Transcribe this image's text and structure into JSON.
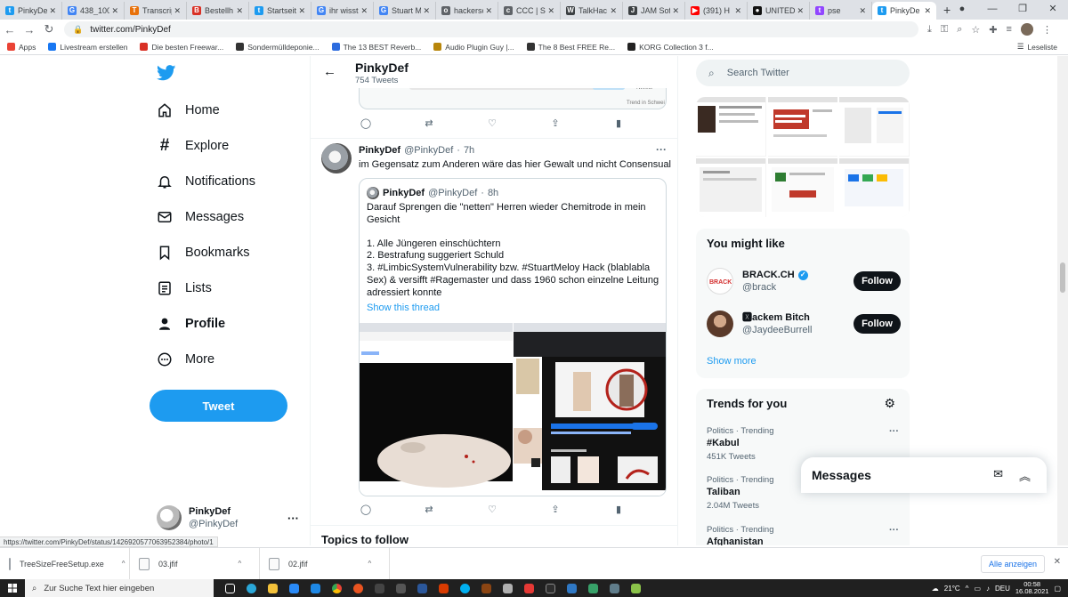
{
  "browser": {
    "tabs": [
      {
        "label": "PinkyDe",
        "color": "#1d9bf0",
        "glyph": "t"
      },
      {
        "label": "438_100",
        "color": "#4285f4",
        "glyph": "G"
      },
      {
        "label": "Transcrip",
        "color": "#e8710a",
        "glyph": "T"
      },
      {
        "label": "Bestellh",
        "color": "#d93025",
        "glyph": "B"
      },
      {
        "label": "Startseit",
        "color": "#1d9bf0",
        "glyph": "t"
      },
      {
        "label": "ihr wisst",
        "color": "#4285f4",
        "glyph": "G"
      },
      {
        "label": "Stuart M",
        "color": "#4285f4",
        "glyph": "G"
      },
      {
        "label": "hackersc",
        "color": "#5f6368",
        "glyph": "o"
      },
      {
        "label": "CCC | Sc",
        "color": "#5f6368",
        "glyph": "c"
      },
      {
        "label": "TalkHac",
        "color": "#3c4043",
        "glyph": "W"
      },
      {
        "label": "JAM Sof",
        "color": "#3c4043",
        "glyph": "J"
      },
      {
        "label": "(391) H",
        "color": "#ff0000",
        "glyph": "▶"
      },
      {
        "label": "UNITED",
        "color": "#111111",
        "glyph": "●"
      },
      {
        "label": "pse",
        "color": "#9146ff",
        "glyph": "t"
      },
      {
        "label": "PinkyDe",
        "color": "#1d9bf0",
        "glyph": "t",
        "active": true
      }
    ],
    "url": "twitter.com/PinkyDef",
    "bookmarks": [
      {
        "label": "Apps",
        "color": "#ea4335"
      },
      {
        "label": "Livestream erstellen",
        "color": "#1877f2"
      },
      {
        "label": "Die besten Freewar...",
        "color": "#d93025"
      },
      {
        "label": "Sondermülldeponie...",
        "color": "#333333"
      },
      {
        "label": "The 13 BEST Reverb...",
        "color": "#2d6cdf"
      },
      {
        "label": "Audio Plugin Guy |...",
        "color": "#b8860b"
      },
      {
        "label": "The 8 Best FREE Re...",
        "color": "#333333"
      },
      {
        "label": "KORG Collection 3 f...",
        "color": "#222222"
      }
    ],
    "reading_list": "Leseliste",
    "status_url": "https://twitter.com/PinkyDef/status/1426920577063952384/photo/1"
  },
  "nav": {
    "items": [
      {
        "label": "Home",
        "icon": "home-icon"
      },
      {
        "label": "Explore",
        "icon": "hashtag-icon"
      },
      {
        "label": "Notifications",
        "icon": "bell-icon"
      },
      {
        "label": "Messages",
        "icon": "envelope-icon"
      },
      {
        "label": "Bookmarks",
        "icon": "bookmark-icon"
      },
      {
        "label": "Lists",
        "icon": "list-icon"
      },
      {
        "label": "Profile",
        "icon": "person-icon",
        "active": true
      },
      {
        "label": "More",
        "icon": "more-circle-icon"
      }
    ],
    "tweet_button": "Tweet",
    "account": {
      "display_name": "PinkyDef",
      "handle": "@PinkyDef",
      "more": "···"
    }
  },
  "profile_header": {
    "title": "PinkyDef",
    "subtitle": "754 Tweets"
  },
  "prev_tweet_media": {
    "text1": "Tweets",
    "text2": "Trend in Schwei"
  },
  "tweet": {
    "display_name": "PinkyDef",
    "handle": "@PinkyDef",
    "sep": "·",
    "time": "7h",
    "more": "···",
    "text": "im Gegensatz zum Anderen wäre das hier Gewalt und nicht Consensual",
    "quote": {
      "display_name": "PinkyDef",
      "handle": "@PinkyDef",
      "sep": "·",
      "time": "8h",
      "lines": [
        "Darauf Sprengen die \"netten\" Herren wieder Chemitrode in mein Gesicht",
        "",
        "1. Alle Jüngeren einschüchtern",
        "2. Bestrafung suggeriert Schuld",
        "3. #LimbicSystemVulnerability bzw. #StuartMeloy Hack (blablabla Sex) & versifft #Ragemaster und dass 1960 schon einzelne Leitung adressiert konnte"
      ],
      "show_thread": "Show this thread"
    }
  },
  "topics_heading": "Topics to follow",
  "search": {
    "placeholder": "Search Twitter"
  },
  "you_might_like": {
    "title": "You might like",
    "accounts": [
      {
        "display_name": "BRACK.CH",
        "handle": "@brack",
        "badge": "verified",
        "follow": "Follow"
      },
      {
        "display_name": "🆇ackem Bitch",
        "handle": "@JaydeeBurrell",
        "badge": "none",
        "follow": "Follow"
      }
    ],
    "show_more": "Show more"
  },
  "trends": {
    "title": "Trends for you",
    "items": [
      {
        "category": "Politics · Trending",
        "name": "#Kabul",
        "count": "451K Tweets"
      },
      {
        "category": "Politics · Trending",
        "name": "Taliban",
        "count": "2.04M Tweets"
      },
      {
        "category": "Politics · Trending",
        "name": "Afghanistan",
        "count": ""
      }
    ]
  },
  "messages_drawer": {
    "title": "Messages"
  },
  "downloads": {
    "items": [
      {
        "name": "TreeSizeFreeSetup.exe",
        "chevron": "^"
      },
      {
        "name": "03.jfif",
        "chevron": "^"
      },
      {
        "name": "02.jfif",
        "chevron": "^"
      }
    ],
    "show_all": "Alle anzeigen",
    "close": "✕"
  },
  "taskbar": {
    "search_placeholder": "Zur Suche Text hier eingeben",
    "temperature": "21°C",
    "language": "DEU",
    "time": "00:58",
    "date": "16.08.2021"
  }
}
